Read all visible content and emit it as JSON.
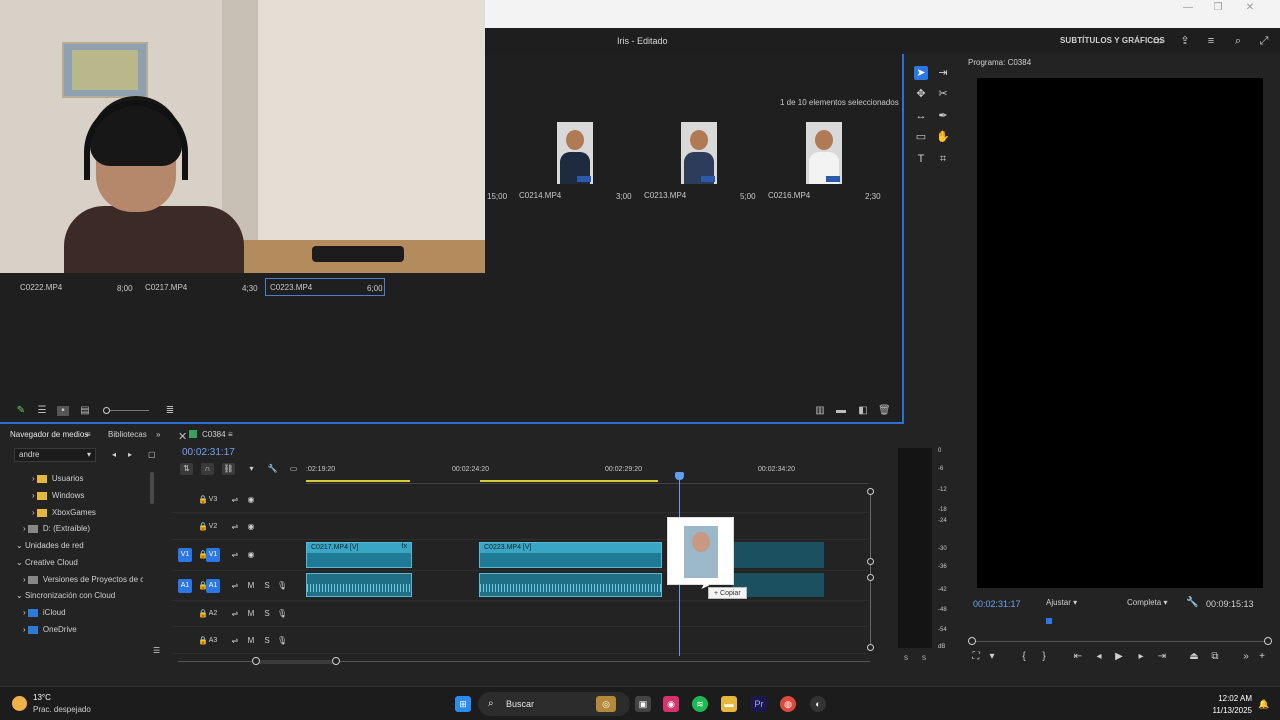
{
  "menubar": {
    "title": "Iris - Editado",
    "subtitles_label": "SUBTÍTULOS Y GRÁFICOS",
    "icons": [
      "panel-icon",
      "export-icon",
      "menu-icon",
      "zoom-icon",
      "fullscreen-icon"
    ]
  },
  "project": {
    "selection_count": "1 de 10 elementos seleccionados",
    "top_clips": [
      {
        "name": "C0214.MP4",
        "duration": "3;00"
      },
      {
        "name": "C0213.MP4",
        "duration": "5;00"
      },
      {
        "name": "C0216.MP4",
        "duration": "2;30"
      }
    ],
    "partial_time": "15;00",
    "bottom_clips": [
      {
        "name": "C0222.MP4",
        "duration": "8;00"
      },
      {
        "name": "C0217.MP4",
        "duration": "4;30"
      },
      {
        "name": "C0223.MP4",
        "duration": "6;00"
      }
    ]
  },
  "program": {
    "label": "Programa: C0384",
    "timecode": "00:02:31:17",
    "fit": "Ajustar",
    "quality": "Completa",
    "duration": "00:09:15:13"
  },
  "media": {
    "tab_media": "Navegador de medios",
    "tab_libraries": "Bibliotecas",
    "user_dropdown": "andre",
    "tree": [
      {
        "label": "Usuarios",
        "icon": "folder"
      },
      {
        "label": "Windows",
        "icon": "folder"
      },
      {
        "label": "XboxGames",
        "icon": "folder"
      },
      {
        "label": "D: (Extraíble)",
        "icon": "drive"
      },
      {
        "label": "Unidades de red",
        "icon": "none"
      },
      {
        "label": "Creative Cloud",
        "icon": "none"
      },
      {
        "label": "Versiones de Proyectos de c",
        "icon": "file"
      },
      {
        "label": "Sincronización con Cloud",
        "icon": "none"
      },
      {
        "label": "iCloud",
        "icon": "cloud"
      },
      {
        "label": "OneDrive",
        "icon": "cloud"
      }
    ]
  },
  "timeline": {
    "sequence": "C0384",
    "timecode": "00:02:31:17",
    "ruler": [
      ":02:19:20",
      "00:02:24:20",
      "00:02:29:20",
      "00:02:34:20"
    ],
    "tracks": [
      {
        "name": "V3",
        "type": "video"
      },
      {
        "name": "V2",
        "type": "video"
      },
      {
        "name": "V1",
        "type": "video"
      },
      {
        "name": "A1",
        "type": "audio"
      },
      {
        "name": "A2",
        "type": "audio"
      },
      {
        "name": "A3",
        "type": "audio"
      }
    ],
    "source_v": "V1",
    "source_a": "A1",
    "clips": [
      {
        "name": "C0217.MP4 [V]"
      },
      {
        "name": "C0223.MP4 [V]"
      }
    ],
    "copy_tooltip": "+ Copiar"
  },
  "meter": {
    "levels": [
      "0",
      "-6",
      "-12",
      "-18",
      "-24",
      "-30",
      "-36",
      "-42",
      "-48",
      "-54",
      "dB"
    ],
    "solo": [
      "S",
      "S"
    ]
  },
  "taskbar": {
    "temperature": "13°C",
    "condition": "Prac. despejado",
    "search": "Buscar",
    "time": "12:02 AM",
    "date": "11/13/2025"
  },
  "colors": {
    "accent": "#2b78e4",
    "timecode": "#6ea3f5",
    "clip": "#1f7a96",
    "work_area": "#d8cc39"
  }
}
